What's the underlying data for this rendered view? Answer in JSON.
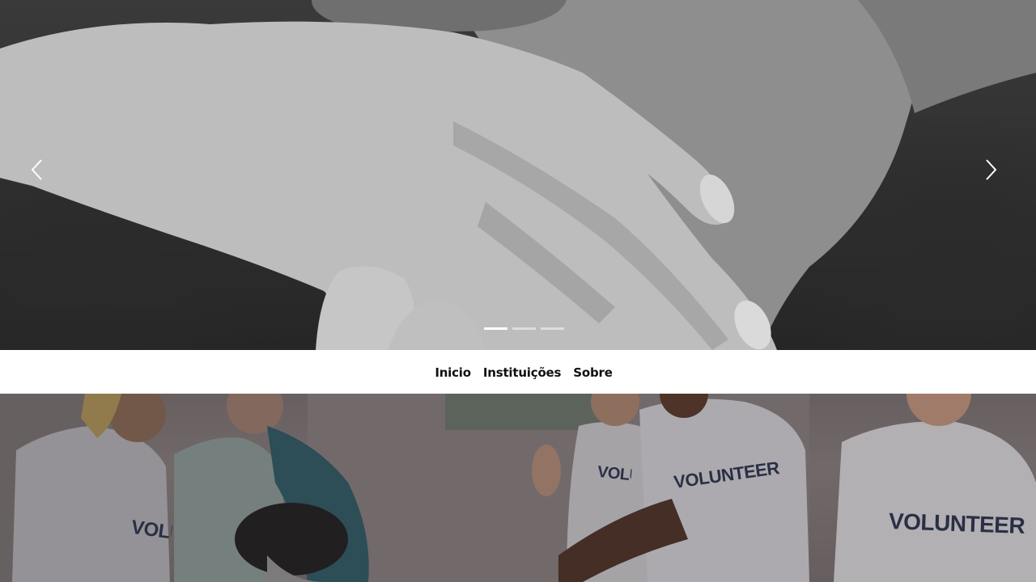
{
  "carousel": {
    "prev_icon": "chevron-left-icon",
    "next_icon": "chevron-right-icon",
    "slides_count": 3,
    "active_slide": 1
  },
  "nav": {
    "items": [
      {
        "label": "Inicio"
      },
      {
        "label": "Instituições"
      },
      {
        "label": "Sobre"
      }
    ]
  },
  "band": {
    "shirts": [
      "VOLUNTEER",
      "VOLUNTEER",
      "VOLUNTEER",
      "VOLUNTEER"
    ]
  }
}
